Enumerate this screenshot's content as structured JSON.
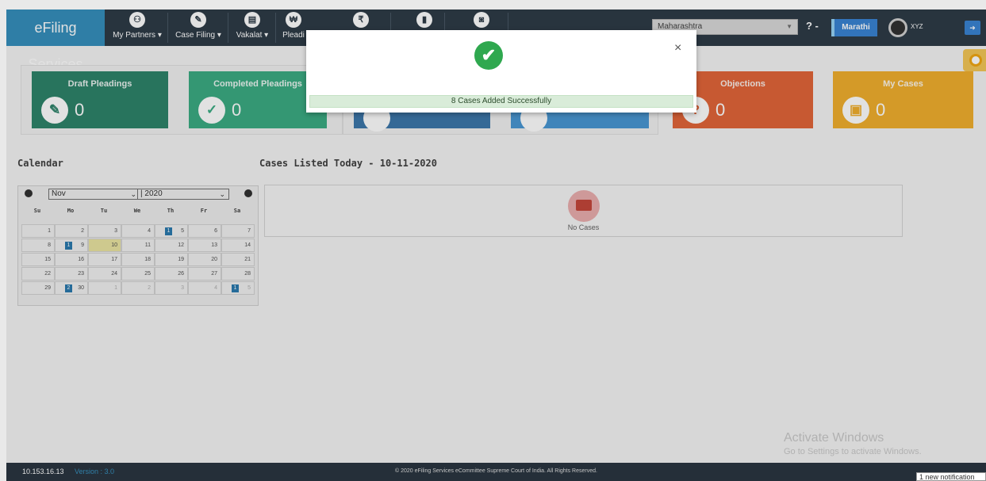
{
  "nav": {
    "brand": "eFiling Services",
    "items": [
      {
        "label": "My Partners",
        "icon": "partners-icon"
      },
      {
        "label": "Case Filing",
        "icon": "pencil-icon"
      },
      {
        "label": "Vakalat",
        "icon": "document-icon"
      },
      {
        "label": "Pleadi",
        "icon": "pleading-icon"
      }
    ],
    "more_icons": [
      "rupee-icon",
      "file-icon",
      "briefcase-icon"
    ],
    "state": "Maharashtra",
    "help": "? -",
    "language": "Marathi",
    "user": "XYZ"
  },
  "cards": [
    {
      "title": "Draft Pleadings",
      "count": "0",
      "color": "#1e7a5e"
    },
    {
      "title": "Completed Pleadings",
      "count": "0",
      "color": "#2ca579"
    },
    {
      "title": "",
      "count": "",
      "color": "#2e6da4"
    },
    {
      "title": "",
      "count": "",
      "color": "#3b8fd0"
    },
    {
      "title": "Objections",
      "count": "0",
      "color": "#e05a2a"
    },
    {
      "title": "My Cases",
      "count": "0",
      "color": "#f0a91e"
    }
  ],
  "calendar": {
    "title": "Calendar",
    "month": "Nov",
    "year": "2020",
    "days_of_week": [
      "Su",
      "Mo",
      "Tu",
      "We",
      "Th",
      "Fr",
      "Sa"
    ],
    "weeks": [
      [
        "1",
        "2",
        "3",
        "4",
        "5",
        "6",
        "7"
      ],
      [
        "8",
        "9",
        "10",
        "11",
        "12",
        "13",
        "14"
      ],
      [
        "15",
        "16",
        "17",
        "18",
        "19",
        "20",
        "21"
      ],
      [
        "22",
        "23",
        "24",
        "25",
        "26",
        "27",
        "28"
      ],
      [
        "29",
        "30",
        "1",
        "2",
        "3",
        "4",
        "5"
      ]
    ],
    "badges": {
      "5": "1",
      "9": "1",
      "30": "2",
      "5b": "1"
    }
  },
  "cases": {
    "title": "Cases Listed Today - 10-11-2020",
    "empty_text": "No Cases"
  },
  "modal": {
    "message": "8 Cases Added Successfully",
    "close": "×"
  },
  "footer": {
    "ip": "10.153.16.13",
    "version": "Version : 3.0",
    "copyright": "© 2020 eFiling Services eCommittee Supreme Court of India. All Rights Reserved."
  },
  "activate": {
    "line1": "Activate Windows",
    "line2": "Go to Settings to activate Windows."
  },
  "notification": "1 new notification"
}
